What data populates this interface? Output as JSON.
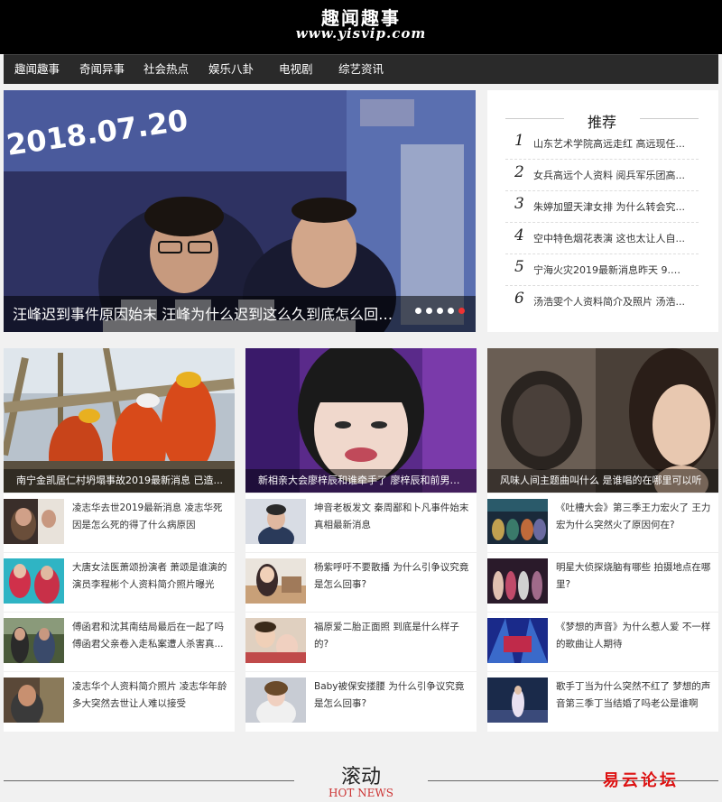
{
  "header": {
    "site_title": "趣闻趣事",
    "site_url": "www.yisvip.com"
  },
  "nav": {
    "items": [
      "趣闻趣事",
      "奇闻异事",
      "社会热点",
      "娱乐八卦",
      "电视剧",
      "综艺资讯"
    ]
  },
  "hero": {
    "image_text": "2018.07.20",
    "title": "汪峰迟到事件原因始末 汪峰为什么迟到这么久到底怎么回事？",
    "slide_count": 5,
    "active_slide": 5
  },
  "recommend": {
    "title": "推荐",
    "items": [
      {
        "num": "1",
        "text": "山东艺术学院高远走红 高远现任..."
      },
      {
        "num": "2",
        "text": "女兵高远个人资料 阅兵军乐团高..."
      },
      {
        "num": "3",
        "text": "朱婷加盟天津女排 为什么转会究..."
      },
      {
        "num": "4",
        "text": "空中特色烟花表演 这也太让人自..."
      },
      {
        "num": "5",
        "text": "宁海火灾2019最新消息昨天 9.29..."
      },
      {
        "num": "6",
        "text": "汤浩雯个人资料简介及照片 汤浩..."
      }
    ]
  },
  "columns": [
    {
      "feature": "南宁金凯居仁村坍塌事故2019最新消息 已造...",
      "items": [
        "凌志华去世2019最新消息 凌志华死因是怎么死的得了什么病原因",
        "大唐女法医萧颂扮演者 萧颂是谁演的演员李程彬个人资料简介照片曝光",
        "傅函君和沈其南结局最后在一起了吗 傅函君父亲卷入走私案遭人杀害真...",
        "凌志华个人资料简介照片 凌志华年龄多大突然去世让人难以接受"
      ]
    },
    {
      "feature": "新相亲大会廖梓辰和谁牵手了 廖梓辰和前男友...",
      "items": [
        "坤音老板发文 秦周鄙和卜凡事件始末真相最新消息",
        "杨紫呼吁不要散播 为什么引争议究竟是怎么回事?",
        "福原爱二胎正面照 到底是什么样子的?",
        "Baby被保安搂腰 为什么引争议究竟是怎么回事?"
      ]
    },
    {
      "feature": "风味人间主题曲叫什么 是谁唱的在哪里可以听",
      "items": [
        "《吐槽大会》第三季王力宏火了 王力宏为什么突然火了原因何在?",
        "明星大侦探烧脑有哪些 拍摄地点在哪里?",
        "《梦想的声音》为什么惹人爱 不一样的歌曲让人期待",
        "歌手丁当为什么突然不红了 梦想的声音第三季丁当结婚了吗老公是谁啊"
      ]
    }
  ],
  "footer": {
    "title": "滚动",
    "subtitle": "HOT NEWS",
    "watermark": "易云论坛"
  }
}
